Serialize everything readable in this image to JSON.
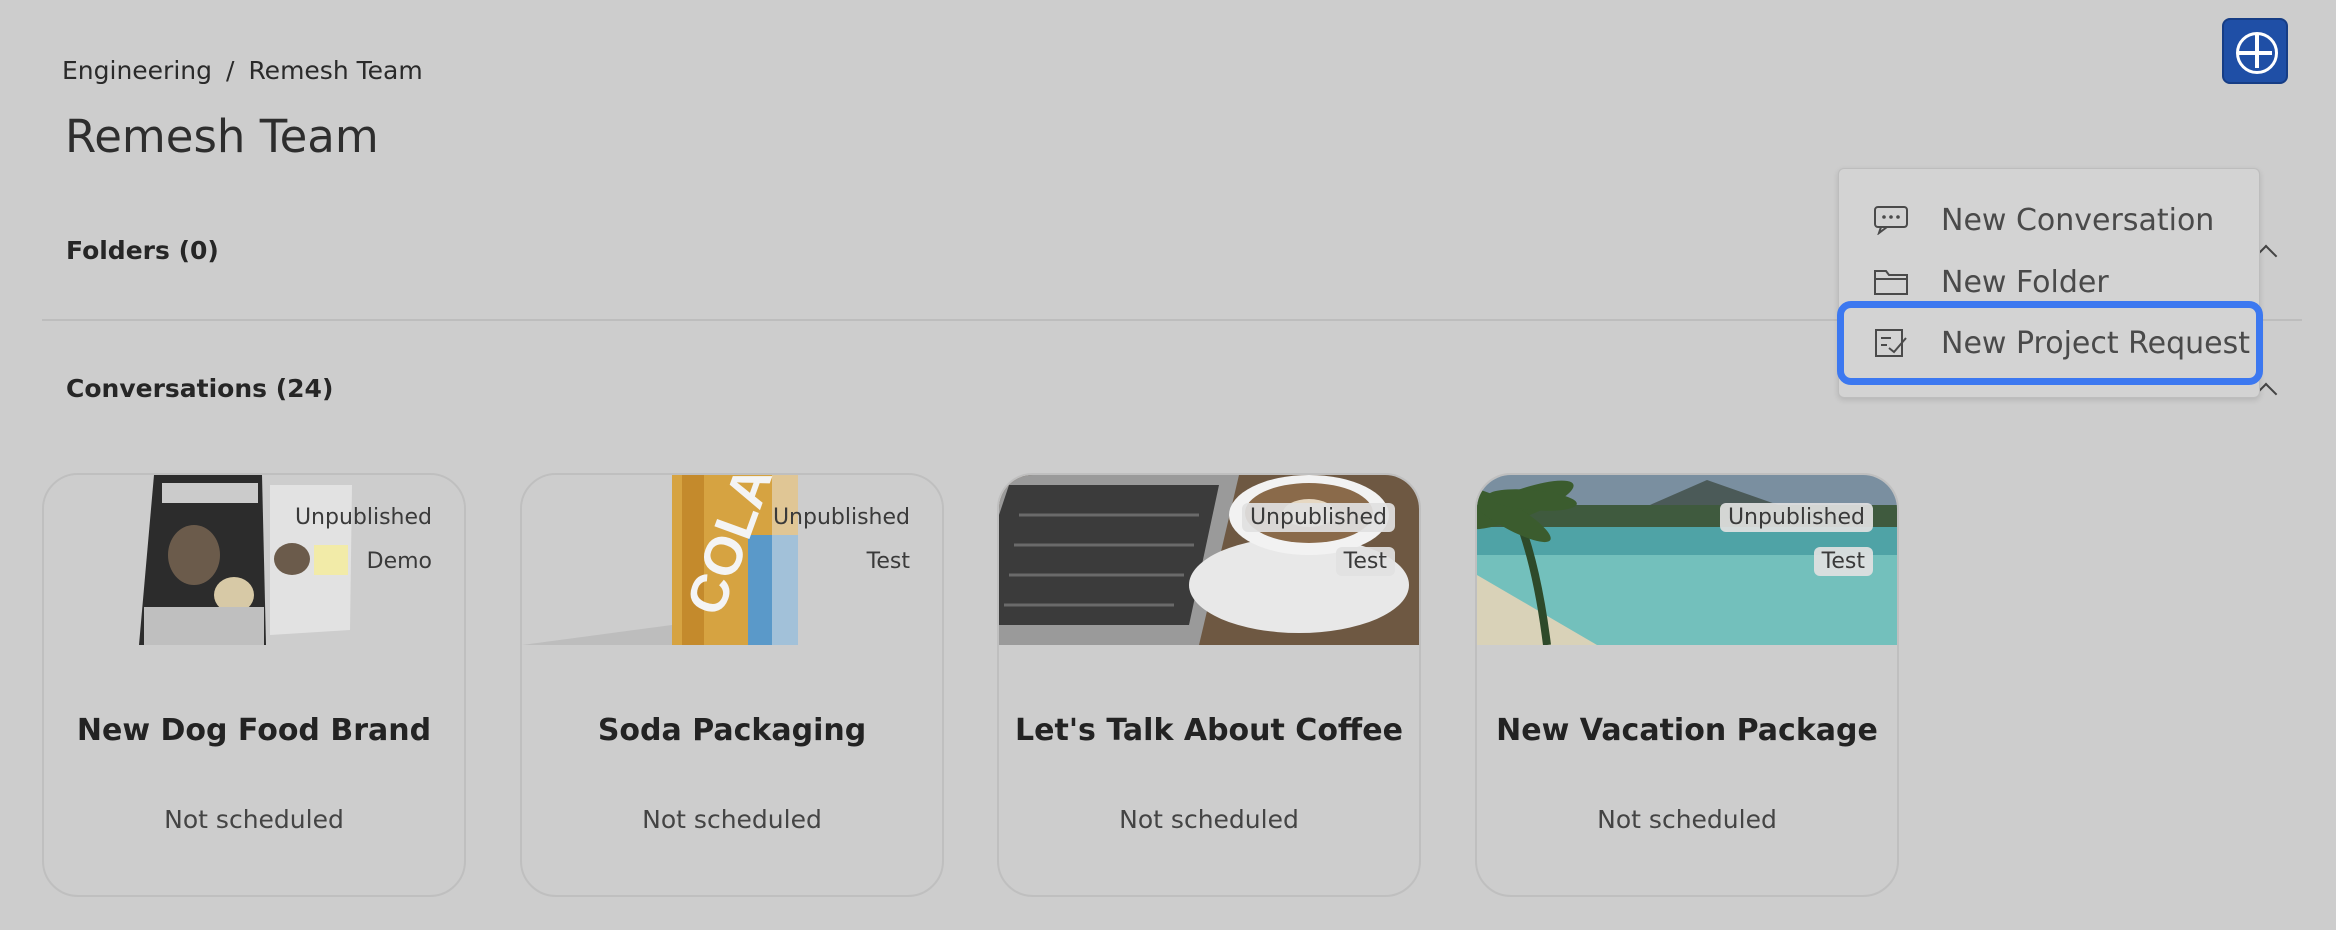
{
  "breadcrumb": {
    "items": [
      "Engineering",
      "Remesh Team"
    ],
    "separator": "/"
  },
  "page_title": "Remesh Team",
  "folders": {
    "header": "Folders (0)"
  },
  "conversations": {
    "header": "Conversations (24)",
    "cards": [
      {
        "title": "New Dog Food Brand",
        "status": "Not scheduled",
        "badges": [
          "Unpublished",
          "Demo"
        ]
      },
      {
        "title": "Soda Packaging",
        "status": "Not scheduled",
        "badges": [
          "Unpublished",
          "Test"
        ]
      },
      {
        "title": "Let's Talk About Coffee",
        "status": "Not scheduled",
        "badges": [
          "Unpublished",
          "Test"
        ]
      },
      {
        "title": "New Vacation Package",
        "status": "Not scheduled",
        "badges": [
          "Unpublished",
          "Test"
        ]
      }
    ]
  },
  "add_menu": {
    "button_icon": "plus-icon",
    "items": [
      {
        "label": "New Conversation",
        "icon": "chat-bubble-icon"
      },
      {
        "label": "New Folder",
        "icon": "folder-icon"
      },
      {
        "label": "New Project Request",
        "icon": "checklist-icon"
      }
    ]
  },
  "colors": {
    "background": "#cdcdcd",
    "accent": "#1f4fa6",
    "focus_ring": "#3c78f0"
  }
}
